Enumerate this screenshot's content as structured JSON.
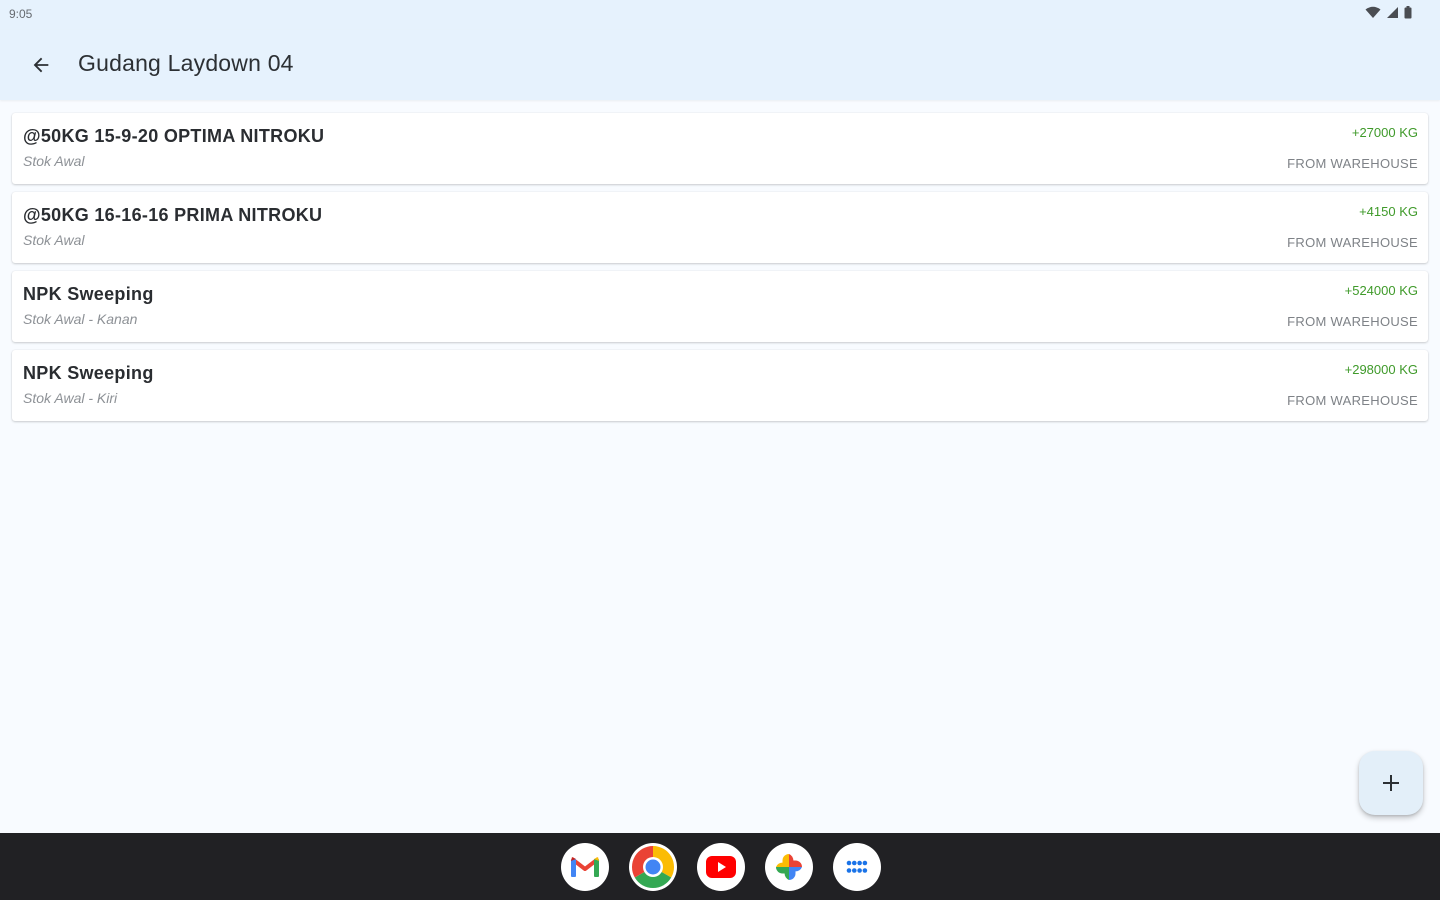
{
  "status_bar": {
    "time": "9:05",
    "icons": [
      "wifi-icon",
      "cell-signal-icon",
      "battery-icon"
    ]
  },
  "app_bar": {
    "title": "Gudang Laydown 04",
    "back_icon": "arrow-back-icon"
  },
  "items": [
    {
      "title": "@50KG 15-9-20 OPTIMA NITROKU",
      "subtitle": "Stok Awal",
      "quantity": "+27000 KG",
      "source": "FROM WAREHOUSE"
    },
    {
      "title": "@50KG 16-16-16 PRIMA NITROKU",
      "subtitle": "Stok Awal",
      "quantity": "+4150 KG",
      "source": "FROM WAREHOUSE"
    },
    {
      "title": "NPK Sweeping",
      "subtitle": "Stok Awal - Kanan",
      "quantity": "+524000 KG",
      "source": "FROM WAREHOUSE"
    },
    {
      "title": "NPK Sweeping",
      "subtitle": "Stok Awal - Kiri",
      "quantity": "+298000 KG",
      "source": "FROM WAREHOUSE"
    }
  ],
  "fab": {
    "icon": "plus-icon"
  },
  "taskbar": {
    "apps": [
      "gmail-icon",
      "chrome-icon",
      "youtube-icon",
      "photos-icon",
      "app-drawer-icon"
    ]
  },
  "colors": {
    "app_bar_bg": "#e6f2fd",
    "page_bg": "#f8fbff",
    "quantity_green": "#3f9a2a",
    "taskbar_bg": "#212124"
  }
}
